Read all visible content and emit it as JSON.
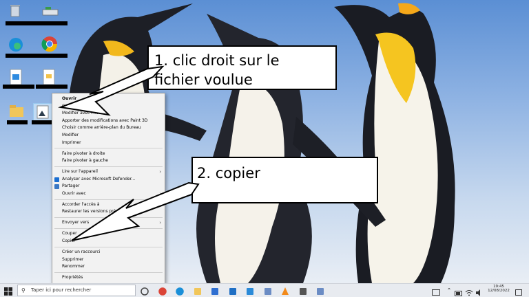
{
  "callouts": {
    "step1_line1": "1. clic droit sur le",
    "step1_line2": "fichier voulue",
    "step2": "2. copier"
  },
  "context_menu": {
    "items": [
      {
        "label": "Ouvrir",
        "bold": true
      },
      {
        "label": "Créer une vidéo"
      },
      {
        "label": "Modifier avec Photos"
      },
      {
        "label": "Apporter des modifications avec Paint 3D"
      },
      {
        "label": "Choisir comme arrière-plan du Bureau"
      },
      {
        "label": "Modifier"
      },
      {
        "label": "Imprimer"
      },
      {
        "separator": true
      },
      {
        "label": "Faire pivoter à droite"
      },
      {
        "label": "Faire pivoter à gauche"
      },
      {
        "separator": true
      },
      {
        "label": "Lire sur l'appareil",
        "submenu": true
      },
      {
        "label": "Analyser avec Microsoft Defender...",
        "icon": "defender-icon"
      },
      {
        "label": "Partager",
        "icon": "share-icon"
      },
      {
        "label": "Ouvrir avec",
        "submenu": true
      },
      {
        "separator": true
      },
      {
        "label": "Accorder l'accès à",
        "submenu": true
      },
      {
        "label": "Restaurer les versions précédentes"
      },
      {
        "separator": true
      },
      {
        "label": "Envoyer vers",
        "submenu": true
      },
      {
        "separator": true
      },
      {
        "label": "Couper"
      },
      {
        "label": "Copier"
      },
      {
        "separator": true
      },
      {
        "label": "Créer un raccourci"
      },
      {
        "label": "Supprimer"
      },
      {
        "label": "Renommer"
      },
      {
        "separator": true
      },
      {
        "label": "Propriétés"
      }
    ]
  },
  "taskbar": {
    "search_placeholder": "Taper ici pour rechercher",
    "time": "19:45",
    "date": "12/08/2022",
    "apps": [
      "task-view-icon",
      "chrome-icon",
      "edge-icon",
      "file-explorer-icon",
      "store-icon",
      "mail-icon",
      "office-l-icon",
      "app-icon",
      "vlc-icon",
      "settings-icon",
      "app-icon"
    ]
  },
  "colors": {
    "sky": "#5b8fd4",
    "menu_bg": "#f2f2f2",
    "taskbar": "#e8ebf0",
    "redaction": "#000000"
  }
}
